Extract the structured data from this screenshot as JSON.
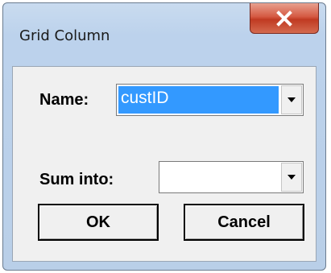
{
  "window": {
    "title": "Grid Column"
  },
  "form": {
    "name_label": "Name:",
    "name_value": "custID",
    "sum_label": "Sum into:",
    "sum_value": ""
  },
  "buttons": {
    "ok": "OK",
    "cancel": "Cancel"
  },
  "icons": {
    "close": "close-icon",
    "dropdown": "chevron-down-icon"
  },
  "colors": {
    "close_button": "#c94a33",
    "selection": "#3399ff",
    "dialog_bg": "#f0f0f0"
  }
}
